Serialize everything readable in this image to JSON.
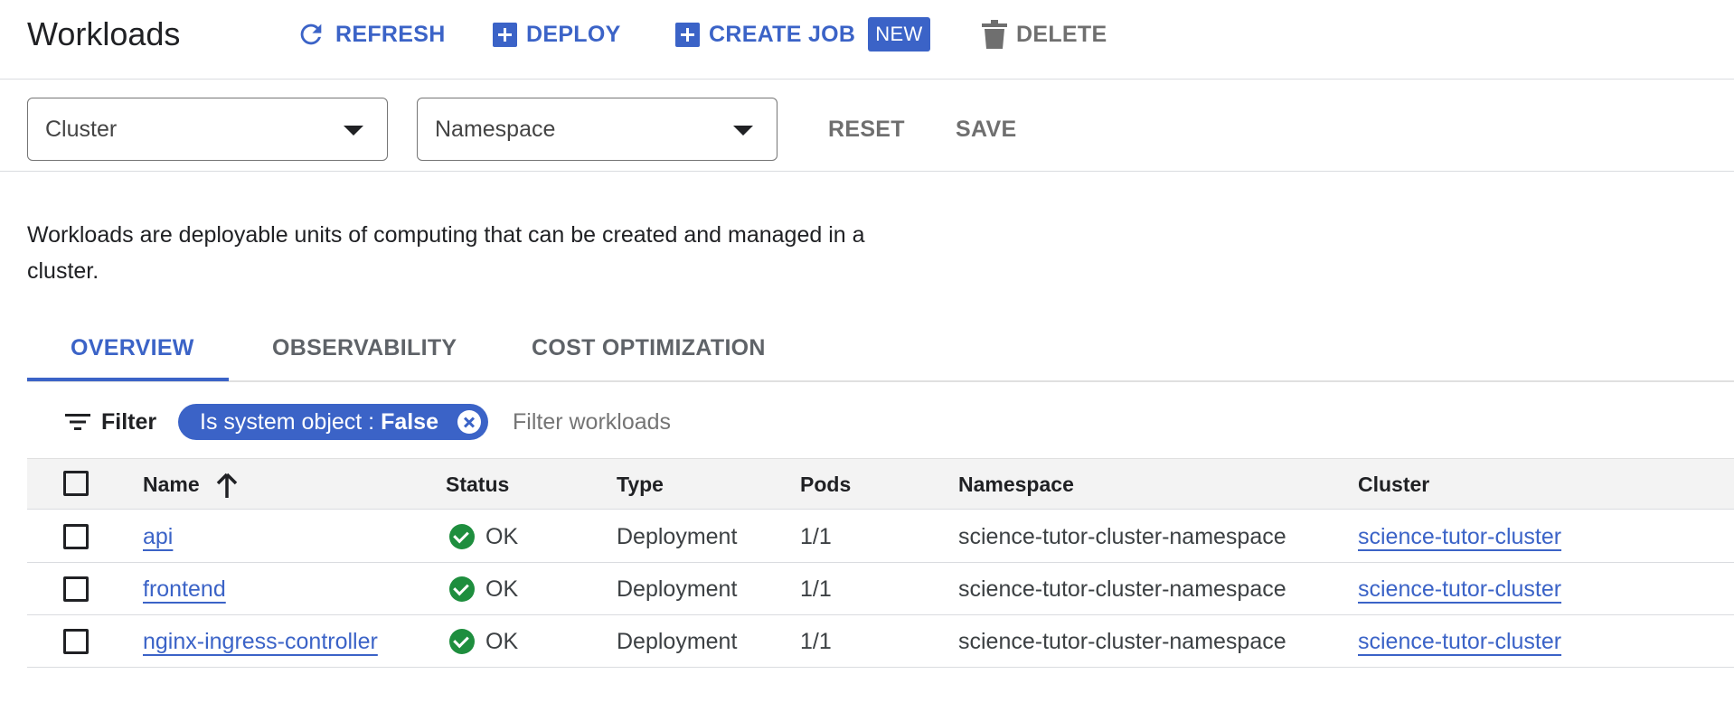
{
  "header": {
    "title": "Workloads",
    "refresh_label": "REFRESH",
    "deploy_label": "DEPLOY",
    "create_job_label": "CREATE JOB",
    "new_badge": "NEW",
    "delete_label": "DELETE"
  },
  "filters": {
    "cluster_select": "Cluster",
    "namespace_select": "Namespace",
    "reset_label": "RESET",
    "save_label": "SAVE"
  },
  "description": "Workloads are deployable units of computing that can be created and managed in a cluster.",
  "tabs": [
    {
      "label": "OVERVIEW",
      "active": true
    },
    {
      "label": "OBSERVABILITY",
      "active": false
    },
    {
      "label": "COST OPTIMIZATION",
      "active": false
    }
  ],
  "filter_bar": {
    "filter_label": "Filter",
    "chip_key": "Is system object : ",
    "chip_value": "False",
    "placeholder": "Filter workloads"
  },
  "table": {
    "columns": {
      "name": "Name",
      "status": "Status",
      "type": "Type",
      "pods": "Pods",
      "namespace": "Namespace",
      "cluster": "Cluster"
    },
    "sort": "Name ascending",
    "rows": [
      {
        "name": "api",
        "status": "OK",
        "type": "Deployment",
        "pods": "1/1",
        "namespace": "science-tutor-cluster-namespace",
        "cluster": "science-tutor-cluster"
      },
      {
        "name": "frontend",
        "status": "OK",
        "type": "Deployment",
        "pods": "1/1",
        "namespace": "science-tutor-cluster-namespace",
        "cluster": "science-tutor-cluster"
      },
      {
        "name": "nginx-ingress-controller",
        "status": "OK",
        "type": "Deployment",
        "pods": "1/1",
        "namespace": "science-tutor-cluster-namespace",
        "cluster": "science-tutor-cluster"
      }
    ]
  },
  "colors": {
    "accent": "#3b63c7",
    "ok_green": "#1e8e3e",
    "disabled_gray": "#6f6f6f"
  },
  "icons": [
    "refresh-icon",
    "plus-box-icon",
    "trash-icon",
    "chevron-down-icon",
    "filter-list-icon",
    "close-circle-icon",
    "arrow-up-icon",
    "check-circle-icon",
    "checkbox-icon"
  ]
}
